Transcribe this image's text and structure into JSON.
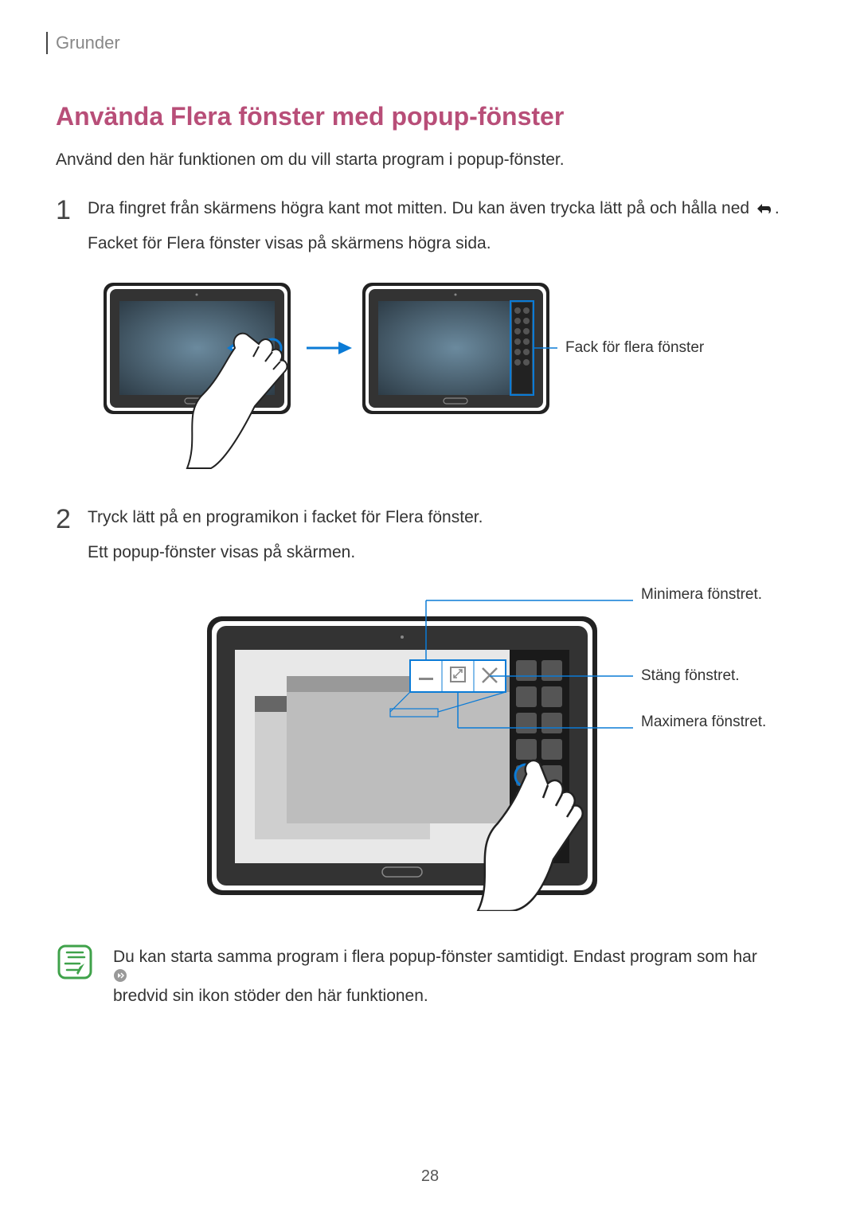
{
  "header": {
    "title": "Grunder"
  },
  "section": {
    "title": "Använda Flera fönster med popup-fönster"
  },
  "intro": "Använd den här funktionen om du vill starta program i popup-fönster.",
  "steps": {
    "1": {
      "num": "1",
      "line1_a": "Dra fingret från skärmens högra kant mot mitten. Du kan även trycka lätt på och hålla ned ",
      "line1_b": ".",
      "line2": "Facket för Flera fönster visas på skärmens högra sida."
    },
    "2": {
      "num": "2",
      "line1": "Tryck lätt på en programikon i facket för Flera fönster.",
      "line2": "Ett popup-fönster visas på skärmen."
    }
  },
  "callouts": {
    "tray": "Fack för flera fönster",
    "minimize": "Minimera fönstret.",
    "close": "Stäng fönstret.",
    "maximize": "Maximera fönstret."
  },
  "note": {
    "text_a": "Du kan starta samma program i flera popup-fönster samtidigt. Endast program som har ",
    "text_b": " bredvid sin ikon stöder den här funktionen."
  },
  "footer": {
    "page": "28"
  }
}
